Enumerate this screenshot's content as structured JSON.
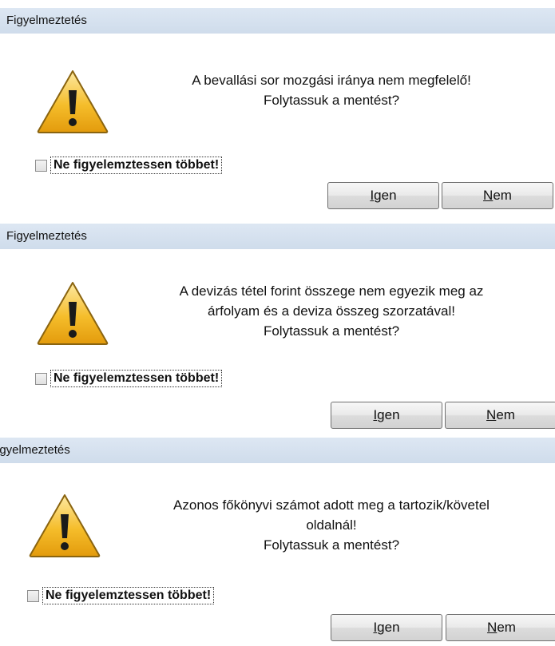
{
  "dialogs": [
    {
      "title": "Figyelmeztetés",
      "message_lines": [
        "A bevallási sor mozgási iránya nem megfelelő!",
        "Folytassuk a mentést?"
      ],
      "checkbox": {
        "label": "Ne figyelemztessen többet!",
        "checked": false
      },
      "buttons": [
        {
          "mnemonic": "I",
          "rest": "gen"
        },
        {
          "mnemonic": "N",
          "rest": "em"
        }
      ]
    },
    {
      "title": "Figyelmeztetés",
      "message_lines": [
        "A devizás tétel forint összege nem egyezik meg az",
        "árfolyam és a deviza összeg szorzatával!",
        "Folytassuk a mentést?"
      ],
      "checkbox": {
        "label": "Ne figyelemztessen többet!",
        "checked": false
      },
      "buttons": [
        {
          "mnemonic": "I",
          "rest": "gen"
        },
        {
          "mnemonic": "N",
          "rest": "em"
        }
      ]
    },
    {
      "title": "igyelmeztetés",
      "message_lines": [
        "Azonos főkönyvi számot adott meg a tartozik/követel",
        "oldalnál!",
        "Folytassuk a mentést?"
      ],
      "checkbox": {
        "label": "Ne figyelemztessen többet!",
        "checked": false
      },
      "buttons": [
        {
          "mnemonic": "I",
          "rest": "gen"
        },
        {
          "mnemonic": "N",
          "rest": "em"
        }
      ]
    }
  ],
  "colors": {
    "titlebar": "#d5e1ee",
    "warning_fill": "#f2b21d",
    "warning_stroke": "#8a6410"
  },
  "icons": {
    "warning": "warning-triangle-icon"
  }
}
